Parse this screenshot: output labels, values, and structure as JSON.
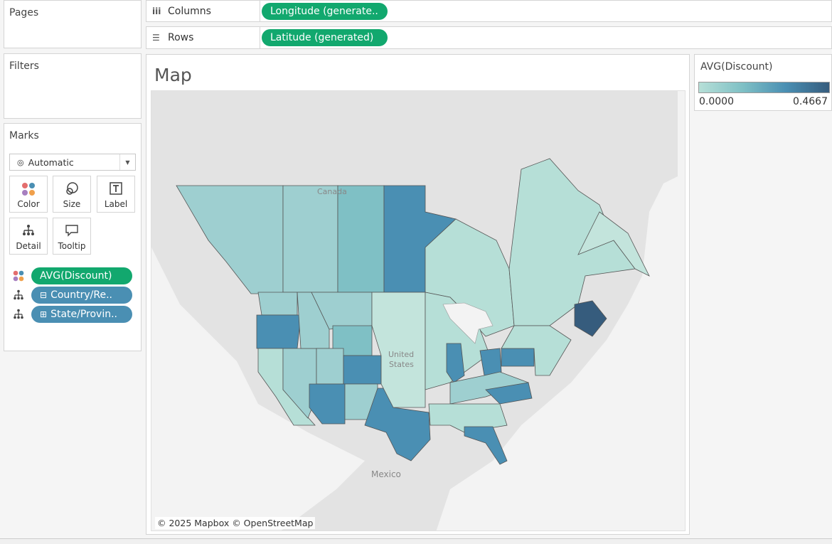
{
  "pages": {
    "title": "Pages"
  },
  "filters": {
    "title": "Filters"
  },
  "columns": {
    "label": "Columns",
    "icon": "columns-icon",
    "pill": "Longitude (generate.."
  },
  "rows": {
    "label": "Rows",
    "icon": "rows-icon",
    "pill": "Latitude (generated)"
  },
  "marks": {
    "title": "Marks",
    "type": "Automatic",
    "buttons": {
      "color": "Color",
      "size": "Size",
      "label": "Label",
      "detail": "Detail",
      "tooltip": "Tooltip"
    },
    "fields": [
      {
        "icon": "color-dots-icon",
        "label": "AVG(Discount)",
        "color": "#12a86e"
      },
      {
        "icon": "detail-tree-icon",
        "label": "Country/Re..",
        "color": "#4a8fb3"
      },
      {
        "icon": "detail-tree-icon",
        "label": "State/Provin..",
        "color": "#4a8fb3"
      }
    ]
  },
  "sheet": {
    "title": "Map"
  },
  "map": {
    "attribution": "© 2025 Mapbox © OpenStreetMap",
    "labels": {
      "canada": "Canada",
      "us_line1": "United",
      "us_line2": "States",
      "mexico": "Mexico"
    }
  },
  "legend": {
    "title": "AVG(Discount)",
    "min": "0.0000",
    "max": "0.4667",
    "colors": {
      "low": "#b6dfd7",
      "high": "#365c7d"
    }
  }
}
